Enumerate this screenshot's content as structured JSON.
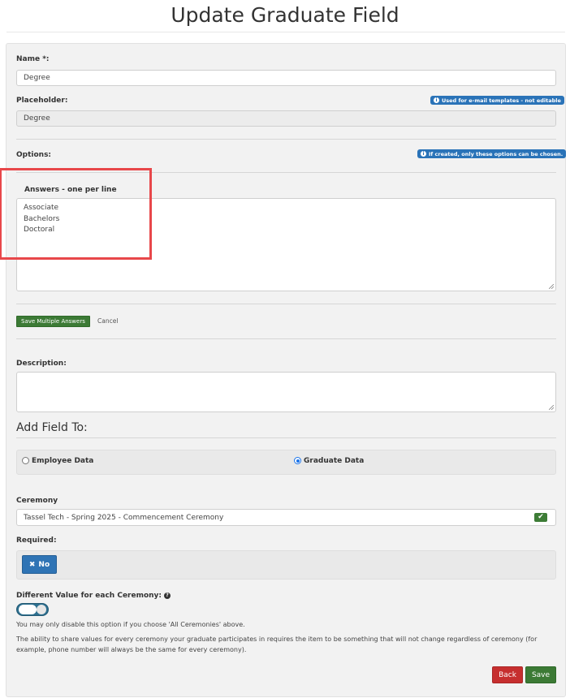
{
  "page": {
    "title": "Update Graduate Field"
  },
  "name_field": {
    "label": "Name *:",
    "value": "Degree"
  },
  "placeholder_field": {
    "label": "Placeholder:",
    "value": "Degree",
    "badge": "Used for e-mail templates - not editable"
  },
  "options": {
    "label": "Options:",
    "badge": "If created, only these options can be chosen.",
    "answers_label": "Answers - one per line",
    "answers": [
      "Associate",
      "Bachelors",
      "Doctoral"
    ],
    "save_label": "Save Multiple Answers",
    "cancel_label": "Cancel"
  },
  "description": {
    "label": "Description:",
    "value": ""
  },
  "add_field_to": {
    "heading": "Add Field To:",
    "options": [
      {
        "label": "Employee Data",
        "selected": false
      },
      {
        "label": "Graduate Data",
        "selected": true
      }
    ]
  },
  "ceremony": {
    "label": "Ceremony",
    "value": "Tassel Tech - Spring 2025 - Commencement Ceremony"
  },
  "required": {
    "label": "Required:",
    "button_label": "No"
  },
  "different_value": {
    "label": "Different Value for each Ceremony:",
    "toggle_on": true,
    "note1": "You may only disable this option if you choose 'All Ceremonies' above.",
    "note2": "The ability to share values for every ceremony your graduate participates in requires the item to be something that will not change regardless of ceremony (for example, phone number will always be the same for every ceremony)."
  },
  "footer": {
    "back_label": "Back",
    "save_label": "Save"
  },
  "colors": {
    "primary": "#2f74b5",
    "success": "#3c7a35",
    "danger": "#c62f2f",
    "highlight": "#e8474a"
  }
}
